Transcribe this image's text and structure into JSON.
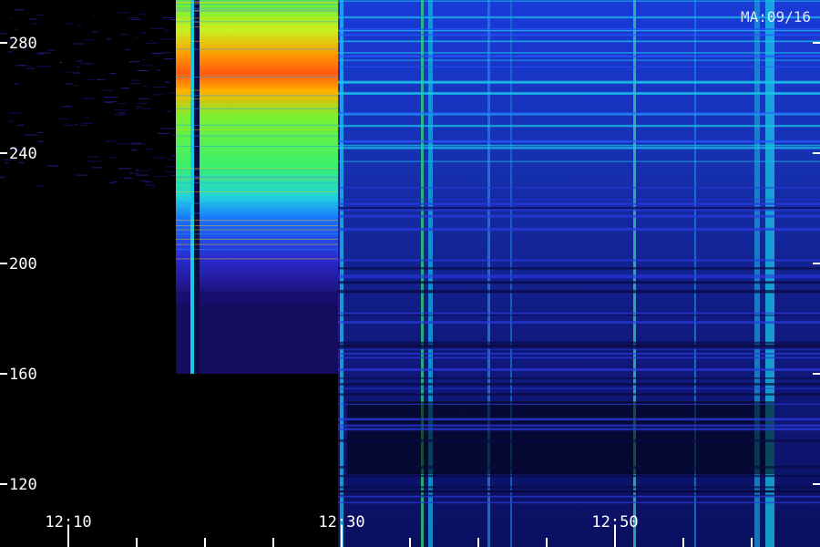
{
  "chart_data": {
    "type": "heatmap",
    "title": "",
    "stamp": "MA:09/16",
    "xlabel": "",
    "ylabel": "",
    "x_ticks_major": [
      "12:10",
      "12:30",
      "12:50"
    ],
    "x_ticks_minor_step_min": 5,
    "xlim": [
      "12:05",
      "13:05"
    ],
    "y_ticks": [
      120,
      160,
      200,
      240,
      280
    ],
    "ylim": [
      110,
      293
    ],
    "colormap": [
      "#000000",
      "#1a0a5c",
      "#2a22d8",
      "#0f6cff",
      "#18d8e8",
      "#3cf060",
      "#c8f020",
      "#ff9a00",
      "#ff2a2a"
    ],
    "regions": [
      {
        "name": "burst-upper",
        "x": [
          "12:18",
          "12:30"
        ],
        "y": [
          240,
          293
        ],
        "level": 0.8
      },
      {
        "name": "burst-peak",
        "x": [
          "12:18",
          "12:30"
        ],
        "y": [
          258,
          285
        ],
        "level": 0.95
      },
      {
        "name": "burst-mid",
        "x": [
          "12:18",
          "12:30"
        ],
        "y": [
          214,
          240
        ],
        "level": 0.6
      },
      {
        "name": "burst-lower",
        "x": [
          "12:18",
          "12:30"
        ],
        "y": [
          180,
          214
        ],
        "level": 0.3
      },
      {
        "name": "post-burst",
        "x": [
          "12:31",
          "13:05"
        ],
        "y": [
          110,
          293
        ],
        "level": 0.25
      }
    ]
  }
}
